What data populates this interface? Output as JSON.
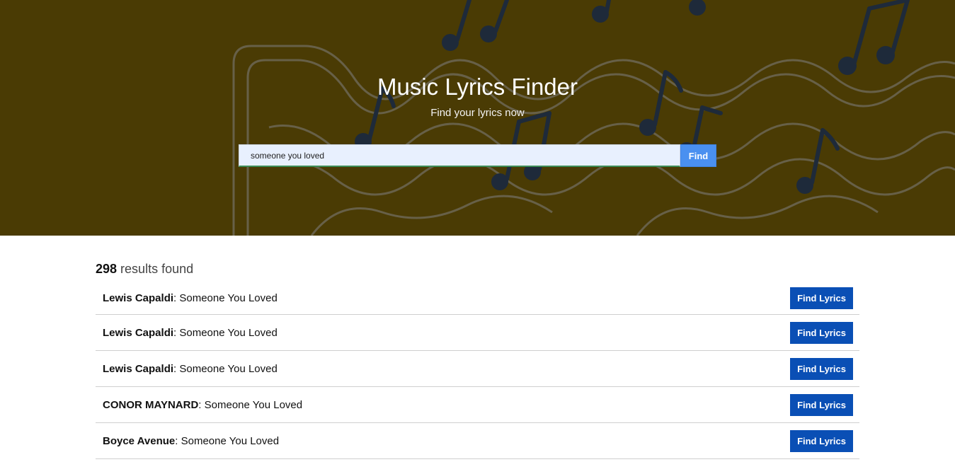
{
  "hero": {
    "title": "Music Lyrics Finder",
    "subtitle": "Find your lyrics now",
    "background_color": "#4a3b04"
  },
  "search": {
    "value": "someone you loved",
    "button_label": "Find"
  },
  "results": {
    "count": "298",
    "count_suffix": " results found",
    "items": [
      {
        "artist": "Lewis Capaldi",
        "title": "Someone You Loved",
        "button_label": "Find Lyrics"
      },
      {
        "artist": "Lewis Capaldi",
        "title": "Someone You Loved",
        "button_label": "Find Lyrics"
      },
      {
        "artist": "Lewis Capaldi",
        "title": "Someone You Loved",
        "button_label": "Find Lyrics"
      },
      {
        "artist": "CONOR MAYNARD",
        "title": "Someone You Loved",
        "button_label": "Find Lyrics"
      },
      {
        "artist": "Boyce Avenue",
        "title": "Someone You Loved",
        "button_label": "Find Lyrics"
      }
    ]
  },
  "colors": {
    "accent_button": "#4a90f0",
    "result_button": "#0a4fb5"
  }
}
